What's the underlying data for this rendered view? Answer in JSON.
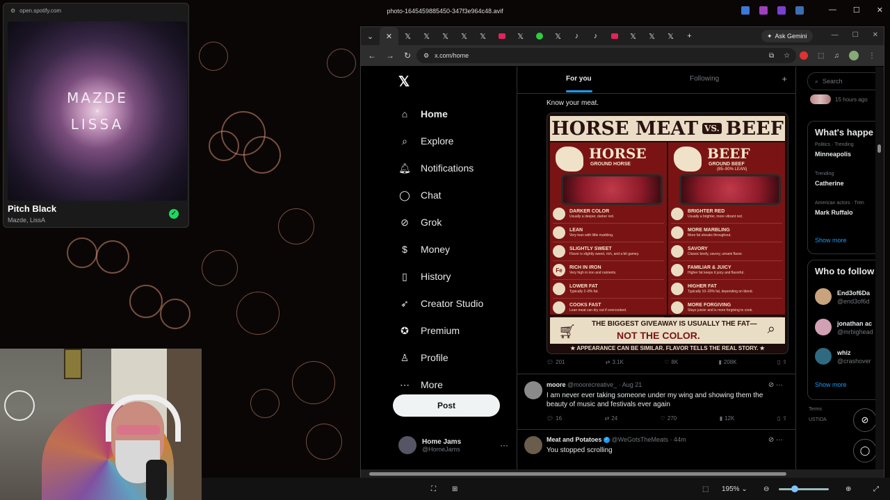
{
  "viewer": {
    "file_name": "photo-1645459885450-347f3e964c48.avif",
    "minimize": "—",
    "maximize": "☐",
    "close": "✕",
    "zoom_level": "195%"
  },
  "spotify": {
    "url": "open.spotify.com",
    "art_line1": "MAZDE",
    "art_line2": "×",
    "art_line3": "LISSA",
    "song_title": "Pitch Black",
    "artists": "Mazde, LissA",
    "check_glyph": "✓"
  },
  "browser": {
    "gemini_label": "Ask Gemini",
    "url": "x.com/home",
    "new_tab": "+"
  },
  "x": {
    "logo": "𝕏",
    "nav": [
      {
        "label": "Home",
        "icon": "home-icon",
        "glyph": "⌂"
      },
      {
        "label": "Explore",
        "icon": "search-icon",
        "glyph": "⌕"
      },
      {
        "label": "Notifications",
        "icon": "bell-icon",
        "glyph": "🔔︎"
      },
      {
        "label": "Chat",
        "icon": "chat-icon",
        "glyph": "◯"
      },
      {
        "label": "Grok",
        "icon": "grok-icon",
        "glyph": "⊘"
      },
      {
        "label": "Money",
        "icon": "money-icon",
        "glyph": "$"
      },
      {
        "label": "History",
        "icon": "bookmark-icon",
        "glyph": "▯"
      },
      {
        "label": "Creator Studio",
        "icon": "rocket-icon",
        "glyph": "➶"
      },
      {
        "label": "Premium",
        "icon": "premium-icon",
        "glyph": "✪"
      },
      {
        "label": "Profile",
        "icon": "person-icon",
        "glyph": "♙"
      },
      {
        "label": "More",
        "icon": "more-icon",
        "glyph": "⋯"
      }
    ],
    "post_button": "Post",
    "account": {
      "name": "Home Jams",
      "handle": "@HomeJams",
      "menu": "···"
    },
    "tabs": {
      "for_you": "For you",
      "following": "Following",
      "plus": "+"
    },
    "tweet1": {
      "caption": "Know your meat.",
      "infographic": {
        "title_left": "HORSE MEAT",
        "title_vs": "VS.",
        "title_right": "BEEF",
        "left_title": "HORSE",
        "left_sub": "GROUND HORSE",
        "right_title": "BEEF",
        "right_sub": "GROUND BEEF",
        "right_sub2": "(85–90% LEAN)",
        "left_rows": [
          {
            "t": "DARKER COLOR",
            "d": "Usually a deeper, darker red."
          },
          {
            "t": "LEAN",
            "d": "Very lean with little marbling."
          },
          {
            "t": "SLIGHTLY SWEET",
            "d": "Flavor is slightly sweet, rich, and a bit gamey."
          },
          {
            "t": "RICH IN IRON",
            "d": "Very high in iron and nutrients.",
            "icon": "Fe"
          },
          {
            "t": "LOWER FAT",
            "d": "Typically 2–8% fat."
          },
          {
            "t": "COOKS FAST",
            "d": "Lean meat can dry out if overcooked."
          }
        ],
        "right_rows": [
          {
            "t": "BRIGHTER RED",
            "d": "Usually a brighter, more vibrant red."
          },
          {
            "t": "MORE MARBLING",
            "d": "More fat streaks throughout."
          },
          {
            "t": "SAVORY",
            "d": "Classic beefy, savory, umami flavor."
          },
          {
            "t": "FAMILIAR & JUICY",
            "d": "Higher fat keeps it juicy and flavorful."
          },
          {
            "t": "HIGHER FAT",
            "d": "Typically 10–20% fat, depending on blend."
          },
          {
            "t": "MORE FORGIVING",
            "d": "Stays juicier and is more forgiving to cook."
          }
        ],
        "banner_line1": "THE BIGGEST GIVEAWAY IS USUALLY THE FAT—",
        "banner_line2": "NOT THE COLOR.",
        "footer": "★ APPEARANCE CAN BE SIMILAR. FLAVOR TELLS THE REAL STORY. ★"
      },
      "stats": {
        "replies": "201",
        "reposts": "3.1K",
        "likes": "8K",
        "views": "208K"
      }
    },
    "tweet2": {
      "name": "moore",
      "handle": "@moorecreative_",
      "time": "· Aug 21",
      "text": "I am never ever taking someone under my wing and showing them the beauty of music and festivals ever again",
      "stats": {
        "replies": "16",
        "reposts": "24",
        "likes": "270",
        "views": "12K"
      }
    },
    "tweet3": {
      "name": "Meat and Potatoes",
      "handle": "@WeGotsTheMeats",
      "time": "· 44m",
      "text": "You stopped scrolling"
    },
    "right": {
      "search_placeholder": "Search",
      "time_ago": "15 hours ago",
      "whats_happening": "What's happe",
      "trends": [
        {
          "cat": "Politics · Trending",
          "name": "Minneapolis"
        },
        {
          "cat": "Trending",
          "name": "Catherine"
        },
        {
          "cat": "American actors · Tren",
          "name": "Mark Ruffalo"
        }
      ],
      "show_more": "Show more",
      "who_to_follow": "Who to follow",
      "follow": [
        {
          "name": "End3of6Da",
          "handle": "@end3of6d",
          "color": "#c9a27e"
        },
        {
          "name": "jonathan ac",
          "handle": "@mrbighead",
          "color": "#d2a0b4"
        },
        {
          "name": "whiz",
          "handle": "@crashover",
          "color": "#2f6a80"
        }
      ],
      "show_more2": "Show more",
      "terms": "Terms",
      "footer2": "USTIDA"
    }
  },
  "colors": {
    "accent": "#1d9bf0",
    "spotify_green": "#1ed760"
  }
}
